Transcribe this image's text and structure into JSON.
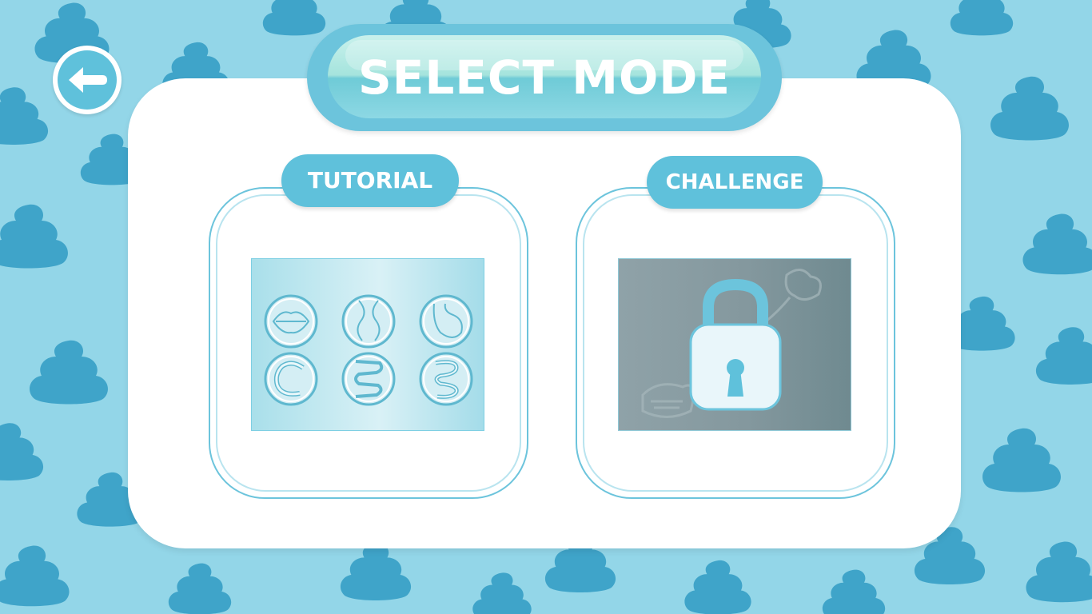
{
  "title": "SELECT MODE",
  "back_button": {
    "icon": "back-arrow-icon"
  },
  "modes": [
    {
      "label": "TUTORIAL",
      "locked": false,
      "thumbnail_icons": [
        "lips-icon",
        "throat-icon",
        "stomach-icon",
        "colon-icon",
        "small-intestine-icon",
        "intestine-icon"
      ]
    },
    {
      "label": "CHALLENGE",
      "locked": true,
      "lock_icon": "padlock-icon"
    }
  ],
  "colors": {
    "background": "#93d6e8",
    "pattern": "#3fa4c9",
    "accent": "#5fc1db",
    "panel": "#ffffff"
  }
}
